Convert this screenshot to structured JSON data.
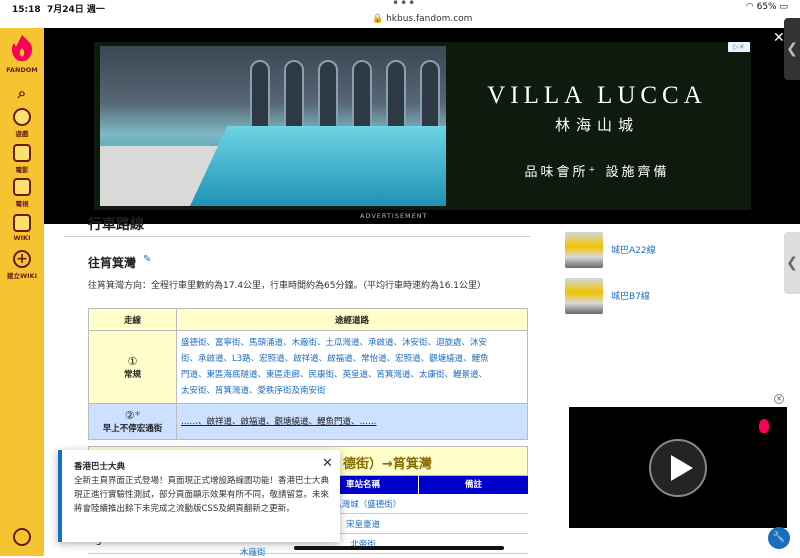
{
  "status": {
    "time": "15:18",
    "date": "7月24日 週一",
    "battery": "65%",
    "url": "hkbus.fandom.com"
  },
  "rail": {
    "brand": "FANDOM",
    "items": [
      {
        "label": "遊戲"
      },
      {
        "label": "電影"
      },
      {
        "label": "電視"
      },
      {
        "label": "WIKI"
      },
      {
        "label": "建立WIKI"
      }
    ]
  },
  "ad": {
    "brand_title": "VILLA LUCCA",
    "brand_cn": "林海山城",
    "tagline": "品味會所⁺ 設施齊備",
    "label": "ADVERTISEMENT"
  },
  "section": {
    "title": "行車路線",
    "subtitle": "往筲箕灣"
  },
  "summary": "往筲箕灣方向：全程行車里數約為17.4公里，行車時間約為65分鐘。（平均行車時速約為16.1公里）",
  "route_table": {
    "headers": [
      "走線",
      "途經道路"
    ],
    "row1": {
      "num": "①",
      "name": "常規",
      "roads_line1": "盛德街、富寧街、馬頭涌道、木廠街、土瓜灣道、承啟道、沐安街、迴旋處、沐安",
      "roads_line2": "街、承啟道、L3路、宏照道、啟祥道、啟福道、常怡道、宏照道、觀塘繞道、鯉魚",
      "roads_line3": "門道、東區海底隧道、東區走廊、民康街、英皇道、筲箕灣道、太康街、鯉景道、",
      "roads_line4": "太安街、筲箕灣道、愛秩序街及南安街"
    },
    "row2": {
      "num": "②",
      "star": "*",
      "name": "早上不停宏通街",
      "roads": "……、啟祥道、啟福道、觀塘繞道、鯉魚門道、……"
    }
  },
  "direction_table": {
    "heading": "德街）→筲箕灣",
    "col_stop": "車站名稱",
    "col_note": "備註",
    "stops": [
      "土瓜灣城（盛德街）",
      "宋皇臺道",
      "北帝街"
    ],
    "row_index": "3",
    "street": "木廠街"
  },
  "related": [
    {
      "name": "城巴A22線"
    },
    {
      "name": "城巴B7線"
    }
  ],
  "toast": {
    "title": "香港巴士大典",
    "body": "全新主頁界面正式登場！頁面現正式增設路線圖功能！香港巴士大典現正進行實驗性測試，部分頁面顯示效果有所不同，敬請留意。未來將會陸續推出餘下未完成之流動版CSS及網頁翻新之更新。"
  },
  "colors": {
    "rail": "#f4c531",
    "link": "#1a6ec0",
    "header_yellow": "#ffffcc",
    "blue_head": "#0000cc"
  }
}
